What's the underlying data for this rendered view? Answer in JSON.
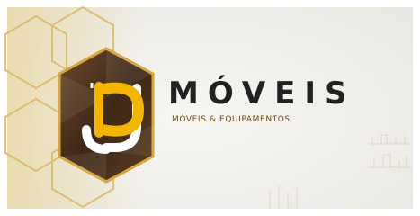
{
  "brand": {
    "logo_lettering": "JP",
    "name": "MÓVEIS",
    "tagline": "MÓVEIS & EQUIPAMENTOS"
  },
  "colors": {
    "background": "#f1f0ec",
    "accent_gold": "#f2b600",
    "hexagon_dark": "#4a3220",
    "hexagon_border": "#d7a640",
    "letter_white": "#ffffff",
    "text_dark": "#222222",
    "tagline_brown": "#6b4a16"
  },
  "icons": {
    "logo": "jp-hexagon-logo"
  }
}
